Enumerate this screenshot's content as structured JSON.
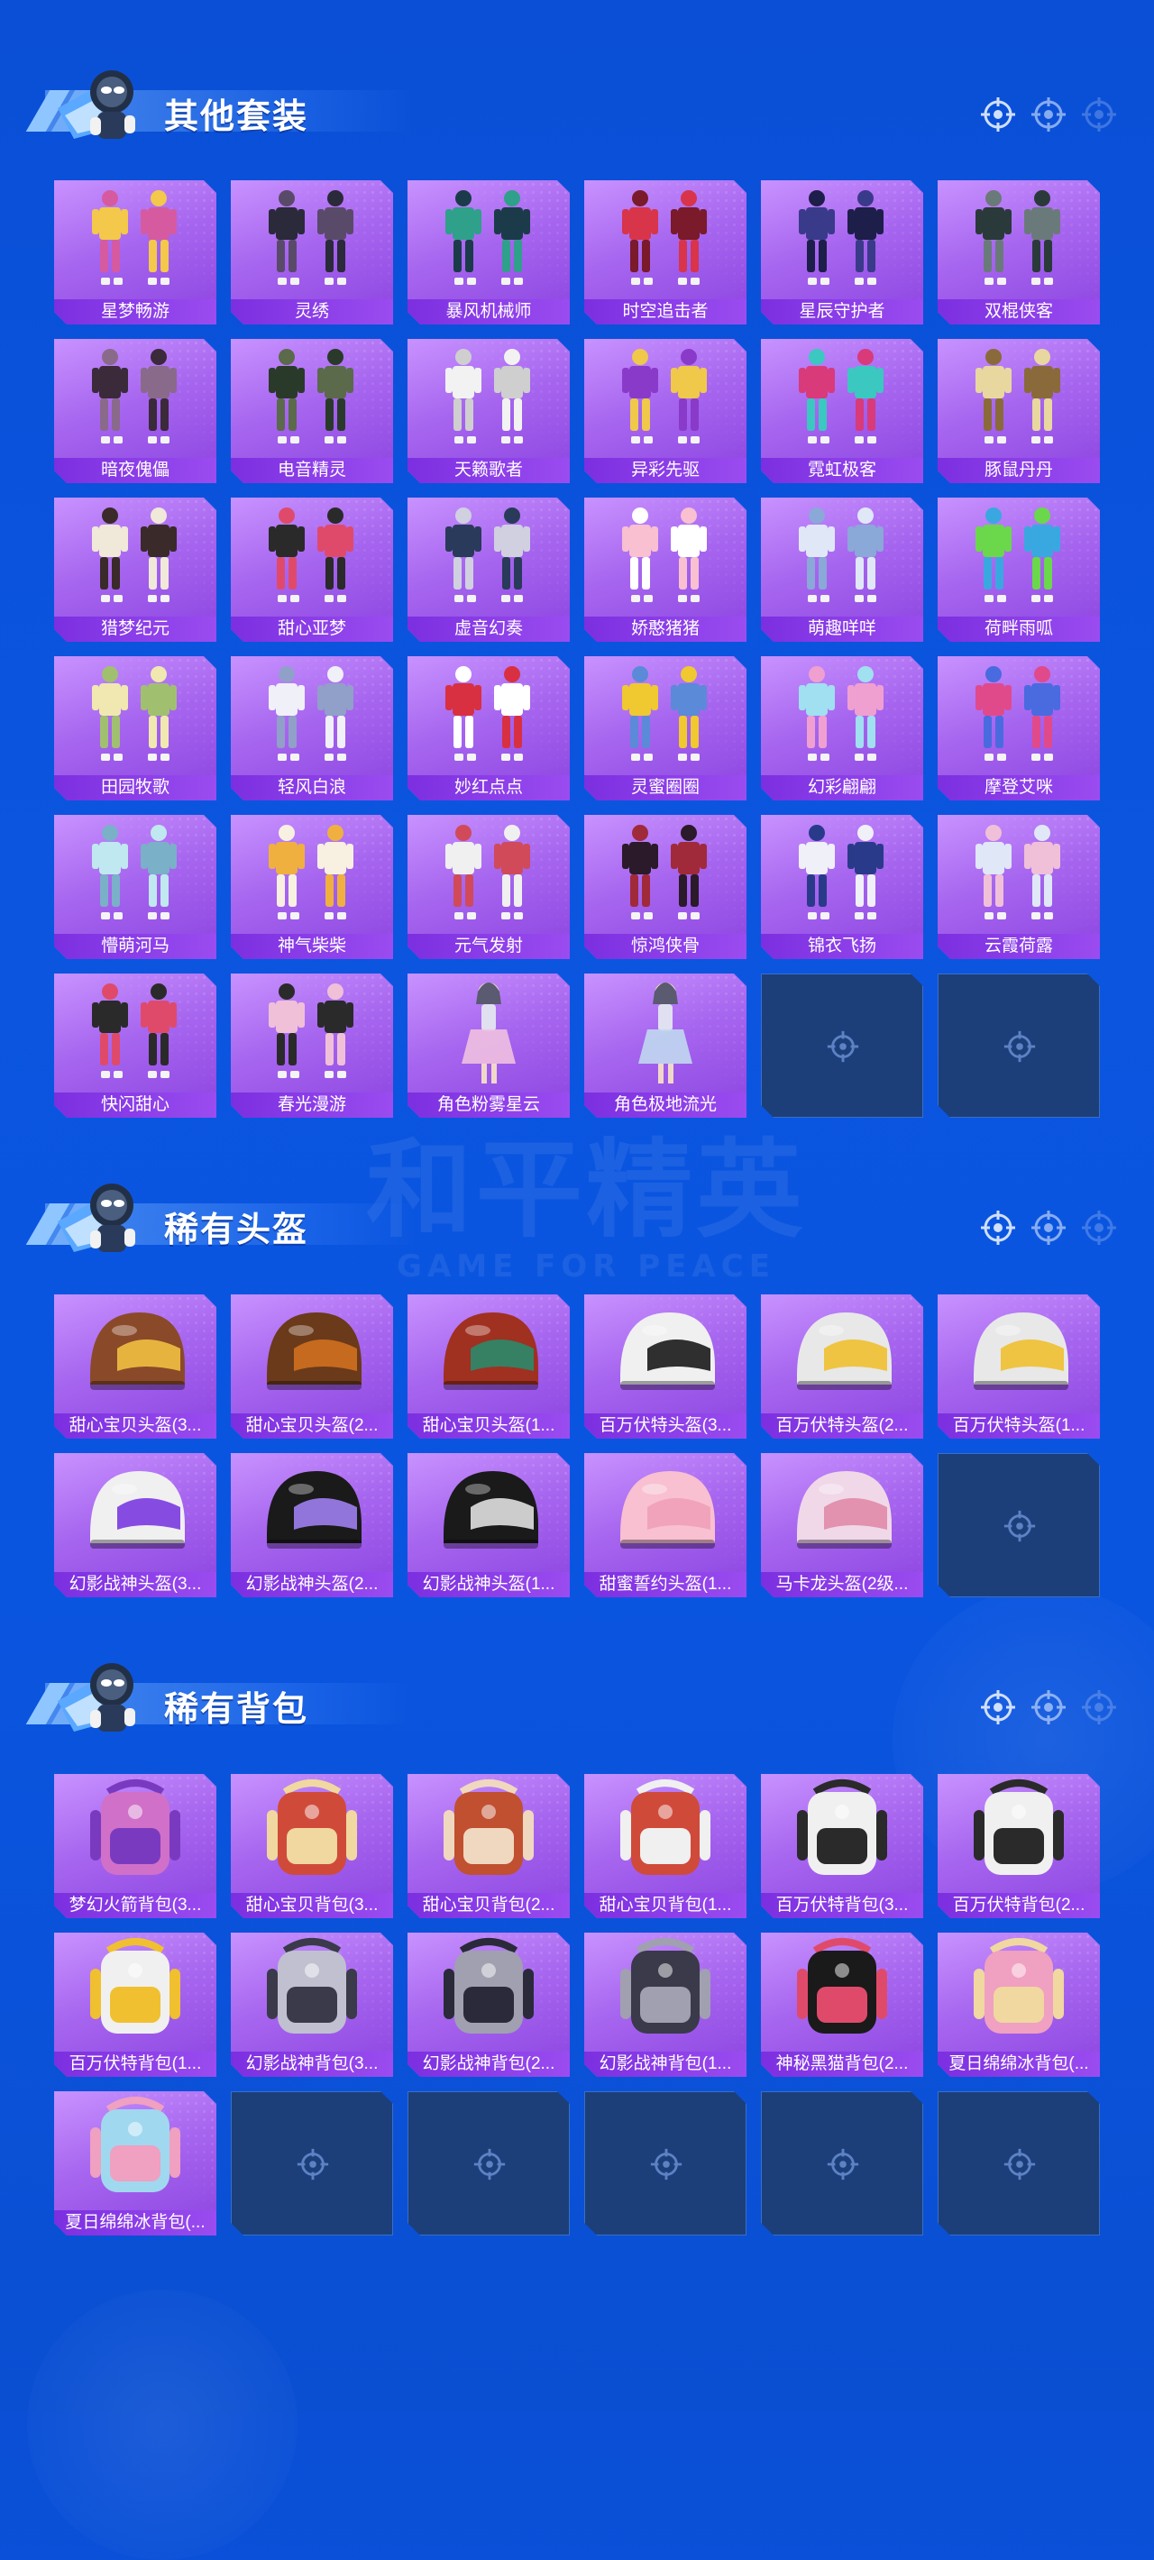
{
  "watermark": {
    "title": "和平精英",
    "subtitle": "GAME FOR PEACE"
  },
  "sections": [
    {
      "title": "其他套装",
      "items": [
        {
          "label": "星梦畅游",
          "icon": "outfit-icon",
          "colors": [
            "#f4c84a",
            "#d65aa0"
          ]
        },
        {
          "label": "灵绣",
          "icon": "outfit-icon",
          "colors": [
            "#2a2a3a",
            "#5a4a6a"
          ]
        },
        {
          "label": "暴风机械师",
          "icon": "outfit-icon",
          "colors": [
            "#2fa08a",
            "#1b3b4a"
          ]
        },
        {
          "label": "时空追击者",
          "icon": "outfit-icon",
          "colors": [
            "#d8344a",
            "#7a1a2a"
          ]
        },
        {
          "label": "星辰守护者",
          "icon": "outfit-icon",
          "colors": [
            "#3a3a8a",
            "#1e1e4a"
          ]
        },
        {
          "label": "双棍侠客",
          "icon": "outfit-icon",
          "colors": [
            "#2a3a3a",
            "#6a7a7a"
          ]
        },
        {
          "label": "暗夜傀儡",
          "icon": "outfit-icon",
          "colors": [
            "#3a2a3a",
            "#8a6a8a"
          ]
        },
        {
          "label": "电音精灵",
          "icon": "outfit-icon",
          "colors": [
            "#2a3a2a",
            "#5a6a4a"
          ]
        },
        {
          "label": "天籁歌者",
          "icon": "outfit-icon",
          "colors": [
            "#f2f2f2",
            "#cfcfcf"
          ]
        },
        {
          "label": "异彩先驱",
          "icon": "outfit-icon",
          "colors": [
            "#8a3ac8",
            "#f0c84a"
          ]
        },
        {
          "label": "霓虹极客",
          "icon": "outfit-icon",
          "colors": [
            "#d83a7a",
            "#3ac8c0"
          ]
        },
        {
          "label": "豚鼠丹丹",
          "icon": "outfit-icon",
          "colors": [
            "#e8d8a0",
            "#8a6a3a"
          ]
        },
        {
          "label": "猎梦纪元",
          "icon": "outfit-icon",
          "colors": [
            "#f0e8d8",
            "#3a2a2a"
          ]
        },
        {
          "label": "甜心亚梦",
          "icon": "outfit-icon",
          "colors": [
            "#2a2a2a",
            "#e04a6a"
          ]
        },
        {
          "label": "虚音幻奏",
          "icon": "outfit-icon",
          "colors": [
            "#2a3a5a",
            "#d0d0e0"
          ]
        },
        {
          "label": "娇憨猪猪",
          "icon": "outfit-icon",
          "colors": [
            "#f8c0d0",
            "#ffffff"
          ]
        },
        {
          "label": "萌趣咩咩",
          "icon": "outfit-icon",
          "colors": [
            "#e0e8f8",
            "#8aa8d8"
          ]
        },
        {
          "label": "荷畔雨呱",
          "icon": "outfit-icon",
          "colors": [
            "#6ad84a",
            "#3aa8e0"
          ]
        },
        {
          "label": "田园牧歌",
          "icon": "outfit-icon",
          "colors": [
            "#f0e8b0",
            "#a0c070"
          ]
        },
        {
          "label": "轻风白浪",
          "icon": "outfit-icon",
          "colors": [
            "#f0f0f8",
            "#90a0c8"
          ]
        },
        {
          "label": "妙红点点",
          "icon": "outfit-icon",
          "colors": [
            "#d83040",
            "#ffffff"
          ]
        },
        {
          "label": "灵蜜圈圈",
          "icon": "outfit-icon",
          "colors": [
            "#f0c830",
            "#5a8ad8"
          ]
        },
        {
          "label": "幻彩翩翩",
          "icon": "outfit-icon",
          "colors": [
            "#a0e0f0",
            "#f0a0d0"
          ]
        },
        {
          "label": "摩登艾咪",
          "icon": "outfit-icon",
          "colors": [
            "#e04a8a",
            "#4a6ae0"
          ]
        },
        {
          "label": "懵萌河马",
          "icon": "outfit-icon",
          "colors": [
            "#c0e8f0",
            "#7ab0c8"
          ]
        },
        {
          "label": "神气柴柴",
          "icon": "outfit-icon",
          "colors": [
            "#f0b040",
            "#f8f0e0"
          ]
        },
        {
          "label": "元气发射",
          "icon": "outfit-icon",
          "colors": [
            "#f0f0f0",
            "#d04a5a"
          ]
        },
        {
          "label": "惊鸿侠骨",
          "icon": "outfit-icon",
          "colors": [
            "#2a1a2a",
            "#a02a3a"
          ]
        },
        {
          "label": "锦衣飞扬",
          "icon": "outfit-icon",
          "colors": [
            "#f0f0f8",
            "#2a3a8a"
          ]
        },
        {
          "label": "云霞荷露",
          "icon": "outfit-icon",
          "colors": [
            "#e0e8f8",
            "#f0c0d8"
          ]
        },
        {
          "label": "快闪甜心",
          "icon": "outfit-icon",
          "colors": [
            "#2a2a2a",
            "#e04a6a"
          ]
        },
        {
          "label": "春光漫游",
          "icon": "outfit-icon",
          "colors": [
            "#f0c0d8",
            "#2a2a2a"
          ]
        },
        {
          "label": "角色粉雾星云",
          "icon": "character-icon",
          "colors": [
            "#f0c0e0",
            "#e0e0f0"
          ]
        },
        {
          "label": "角色极地流光",
          "icon": "character-icon",
          "colors": [
            "#c0d8f0",
            "#e0e0f0"
          ]
        },
        {
          "empty": true
        },
        {
          "empty": true
        }
      ]
    },
    {
      "title": "稀有头盔",
      "items": [
        {
          "label": "甜心宝贝头盔(3...",
          "icon": "helmet-icon",
          "colors": [
            "#8a4a2a",
            "#f0c040"
          ]
        },
        {
          "label": "甜心宝贝头盔(2...",
          "icon": "helmet-icon",
          "colors": [
            "#6a3a1a",
            "#d07020"
          ]
        },
        {
          "label": "甜心宝贝头盔(1...",
          "icon": "helmet-icon",
          "colors": [
            "#a03020",
            "#2a8a6a"
          ]
        },
        {
          "label": "百万伏特头盔(3...",
          "icon": "helmet-icon",
          "colors": [
            "#f0f0f0",
            "#1a1a1a"
          ]
        },
        {
          "label": "百万伏特头盔(2...",
          "icon": "helmet-icon",
          "colors": [
            "#e8e8e8",
            "#f0c030"
          ]
        },
        {
          "label": "百万伏特头盔(1...",
          "icon": "helmet-icon",
          "colors": [
            "#e8e8e8",
            "#f0c030"
          ]
        },
        {
          "label": "幻影战神头盔(3...",
          "icon": "helmet-icon",
          "colors": [
            "#f0f0f0",
            "#7a3ae0"
          ]
        },
        {
          "label": "幻影战神头盔(2...",
          "icon": "helmet-icon",
          "colors": [
            "#1a1a1a",
            "#a080f0"
          ]
        },
        {
          "label": "幻影战神头盔(1...",
          "icon": "helmet-icon",
          "colors": [
            "#1a1a1a",
            "#e0e0e0"
          ]
        },
        {
          "label": "甜蜜誓约头盔(1...",
          "icon": "helmet-icon",
          "colors": [
            "#f8c0d0",
            "#f0a0b8"
          ]
        },
        {
          "label": "马卡龙头盔(2级...",
          "icon": "helmet-icon",
          "colors": [
            "#f0d8e8",
            "#e08aa8"
          ]
        },
        {
          "empty": true
        }
      ]
    },
    {
      "title": "稀有背包",
      "items": [
        {
          "label": "梦幻火箭背包(3...",
          "icon": "backpack-icon",
          "colors": [
            "#d070c8",
            "#7a3ac0"
          ]
        },
        {
          "label": "甜心宝贝背包(3...",
          "icon": "backpack-icon",
          "colors": [
            "#d04a3a",
            "#f0d8a0"
          ]
        },
        {
          "label": "甜心宝贝背包(2...",
          "icon": "backpack-icon",
          "colors": [
            "#c05030",
            "#f0d8c0"
          ]
        },
        {
          "label": "甜心宝贝背包(1...",
          "icon": "backpack-icon",
          "colors": [
            "#d04a3a",
            "#f0f0f0"
          ]
        },
        {
          "label": "百万伏特背包(3...",
          "icon": "backpack-icon",
          "colors": [
            "#f0f0f0",
            "#2a2a2a"
          ]
        },
        {
          "label": "百万伏特背包(2...",
          "icon": "backpack-icon",
          "colors": [
            "#f0f0f0",
            "#2a2a2a"
          ]
        },
        {
          "label": "百万伏特背包(1...",
          "icon": "backpack-icon",
          "colors": [
            "#f0f0f0",
            "#f0c030"
          ]
        },
        {
          "label": "幻影战神背包(3...",
          "icon": "backpack-icon",
          "colors": [
            "#c0c0d0",
            "#3a3a4a"
          ]
        },
        {
          "label": "幻影战神背包(2...",
          "icon": "backpack-icon",
          "colors": [
            "#a0a0b0",
            "#2a2a3a"
          ]
        },
        {
          "label": "幻影战神背包(1...",
          "icon": "backpack-icon",
          "colors": [
            "#3a3a4a",
            "#a0a0b0"
          ]
        },
        {
          "label": "神秘黑猫背包(2...",
          "icon": "backpack-icon",
          "colors": [
            "#1a1a1a",
            "#e04a6a"
          ]
        },
        {
          "label": "夏日绵绵冰背包(...",
          "icon": "backpack-icon",
          "colors": [
            "#f0a0c0",
            "#f0d8a0"
          ]
        },
        {
          "label": "夏日绵绵冰背包(...",
          "icon": "backpack-icon",
          "colors": [
            "#a0d8f0",
            "#f0a0c0"
          ]
        },
        {
          "empty": true
        },
        {
          "empty": true
        },
        {
          "empty": true
        },
        {
          "empty": true
        },
        {
          "empty": true
        }
      ]
    }
  ]
}
